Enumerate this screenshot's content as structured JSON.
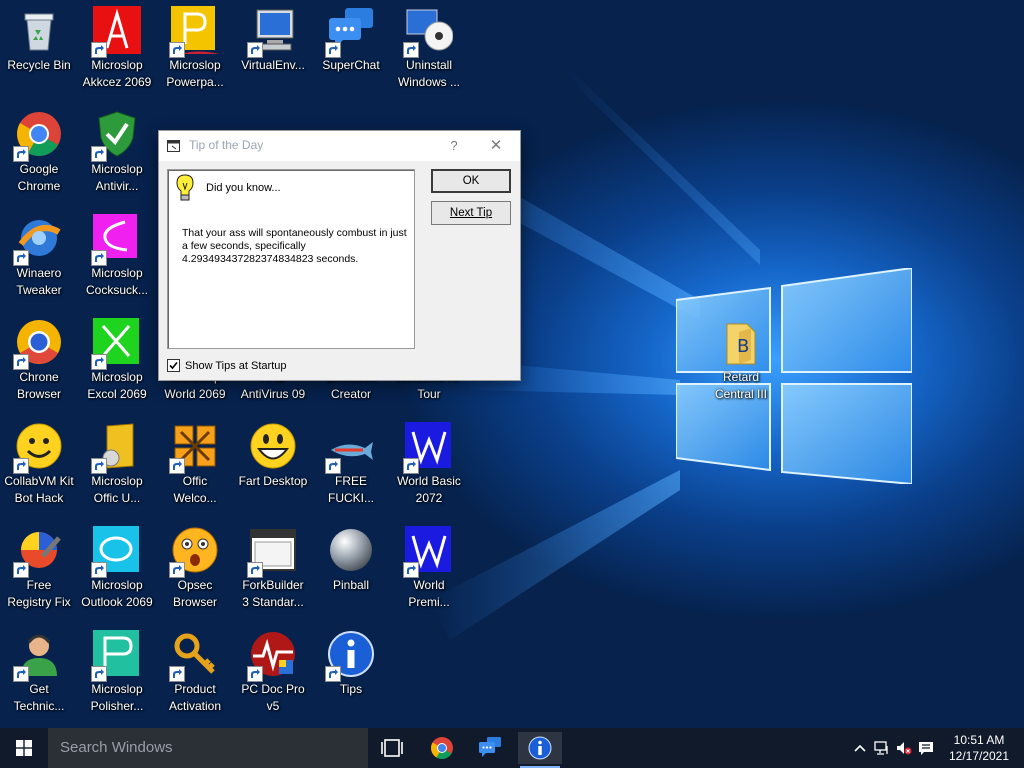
{
  "desktop": {
    "icons": [
      {
        "label": "Recycle Bin",
        "icon": "recycle-bin-icon"
      },
      {
        "label": "Microslop\nAkkcez 2069",
        "icon": "access-icon"
      },
      {
        "label": "Microslop\nPowerpa...",
        "icon": "powerpoint-icon"
      },
      {
        "label": "VirtualEnv...",
        "icon": "computer-icon"
      },
      {
        "label": "SuperChat",
        "icon": "chat-icon"
      },
      {
        "label": "Uninstall\nWindows ...",
        "icon": "uninstall-icon"
      },
      {
        "label": "Google\nChrome",
        "icon": "chrome-icon"
      },
      {
        "label": "Microslop\nAntivir...",
        "icon": "shield-check-icon"
      },
      {
        "label": "Winaero\nTweaker",
        "icon": "tweaker-icon"
      },
      {
        "label": "Microslop\nCocksuck...",
        "icon": "pink-app-icon"
      },
      {
        "label": "Chrone\nBrowser",
        "icon": "chrone-icon"
      },
      {
        "label": "Microslop\nExcol 2069",
        "icon": "excel-icon"
      },
      {
        "label": "Microslop\nWorld 2069",
        "icon": "word-icon"
      },
      {
        "label": "AND\nAntiVirus 09",
        "icon": "antivirus-icon"
      },
      {
        "label": "Emoticon\nCreator",
        "icon": "emoticon-icon"
      },
      {
        "label": "Windows XP\nTour",
        "icon": "xp-tour-icon"
      },
      {
        "label": "CollabVM Kit\nBot Hack",
        "icon": "smiley-icon"
      },
      {
        "label": "Microslop\nOffic U...",
        "icon": "office-update-icon"
      },
      {
        "label": "Offic\nWelco...",
        "icon": "office-logo-icon"
      },
      {
        "label": "Fart Desktop",
        "icon": "grin-icon"
      },
      {
        "label": "FREE\nFUCKI...",
        "icon": "fish-icon"
      },
      {
        "label": "World Basic\n2072",
        "icon": "world-basic-icon"
      },
      {
        "label": "Free\nRegistry Fix",
        "icon": "registry-fix-icon"
      },
      {
        "label": "Microslop\nOutlook 2069",
        "icon": "outlook-icon"
      },
      {
        "label": "Opsec\nBrowser",
        "icon": "shocked-face-icon"
      },
      {
        "label": "ForkBuilder\n3 Standar...",
        "icon": "window-app-icon"
      },
      {
        "label": "Pinball",
        "icon": "pinball-icon"
      },
      {
        "label": "World\nPremi...",
        "icon": "world-premium-icon"
      },
      {
        "label": "Get\nTechnic...",
        "icon": "support-agent-icon"
      },
      {
        "label": "Microslop\nPolisher...",
        "icon": "polisher-icon"
      },
      {
        "label": "Product\nActivation",
        "icon": "key-icon"
      },
      {
        "label": "PC Doc Pro\nv5",
        "icon": "pc-doc-icon"
      },
      {
        "label": "Tips",
        "icon": "info-icon"
      },
      {
        "label": "Retard\nCentral III",
        "icon": "folder-icon"
      }
    ]
  },
  "dialog": {
    "title": "Tip of the Day",
    "help_label": "?",
    "close_label": "✕",
    "heading": "Did you know...",
    "tip": "That your ass will spontaneously combust in just a few seconds, specifically 4.293493437282374834823 seconds.",
    "ok_label": "OK",
    "next_tip_label": "Next Tip",
    "show_tips_label": "Show Tips at Startup",
    "show_tips_checked": true
  },
  "taskbar": {
    "search_placeholder": "Search Windows",
    "pinned": [
      "task-view-icon",
      "chrome-icon",
      "chat-icon",
      "info-icon"
    ],
    "clock_time": "10:51 AM",
    "clock_date": "12/17/2021"
  },
  "colors": {
    "accent": "#1566c9",
    "taskbar": "#101a2a"
  }
}
